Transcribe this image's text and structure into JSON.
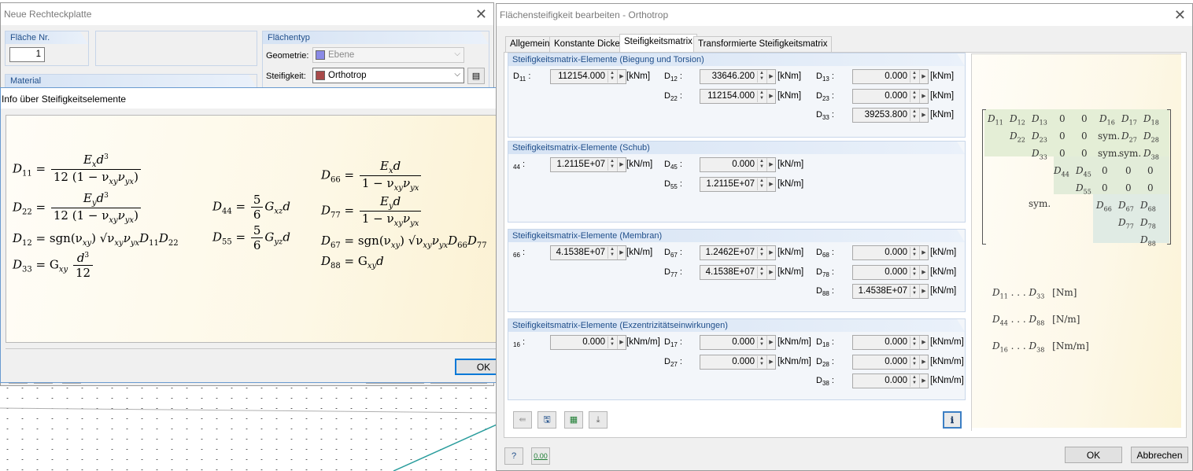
{
  "bg": {
    "window_title": "Neue Rechteckplatte",
    "flaeche_group": "Fläche Nr.",
    "flaeche_value": "1",
    "material_group": "Material",
    "flaechentyp_group": "Flächentyp",
    "geometrie_label": "Geometrie:",
    "geometrie_value": "Ebene",
    "steifigkeit_label": "Steifigkeit:",
    "steifigkeit_value": "Orthotrop",
    "geometrie_color": "#8a8ae6",
    "steifigkeit_color": "#a84a4a"
  },
  "info": {
    "title": "Info über Steifigkeitselemente",
    "ok": "OK",
    "f": {
      "d11": "D",
      "d11s": "11",
      "d11n": "E",
      "d11ns": "x",
      "d11n2": "d",
      "d11d": "12 (1 − ν",
      "d11ds": "xy",
      "d11d2": "ν",
      "d11ds2": "yx",
      "d11d3": ")",
      "d22": "D",
      "d22s": "22",
      "d22n": "E",
      "d22ns": "y",
      "d22n2": "d",
      "d22d": "12 (1 − ν",
      "d22ds": "xy",
      "d22d2": "ν",
      "d22ds2": "yx",
      "d22d3": ")",
      "d12": "D",
      "d12s": "12",
      "d12r": " = sgn(ν",
      "d12rs": "xy",
      "d12r2": ") √ν",
      "d12r2s": "xy",
      "d12r3": "ν",
      "d12r3s": "yx",
      "d12r4": "D",
      "d12r4s": "11",
      "d12r5": "D",
      "d12r5s": "22",
      "d33": "D",
      "d33s": "33",
      "d33r": " = G",
      "d33rs": "xy",
      "d33n": "d",
      "d33nsup": "3",
      "d33d": "12",
      "d44": "D",
      "d44s": "44",
      "d44n": "5",
      "d44d": "6",
      "d44r": "G",
      "d44rs": "xz",
      "d44r2": "d",
      "d55": "D",
      "d55s": "55",
      "d55n": "5",
      "d55d": "6",
      "d55r": "G",
      "d55rs": "yz",
      "d55r2": "d",
      "d66": "D",
      "d66s": "66",
      "d66n": "E",
      "d66ns": "x",
      "d66n2": "d",
      "d66d": "1 − ν",
      "d66ds": "xy",
      "d66d2": "ν",
      "d66ds2": "yx",
      "d77": "D",
      "d77s": "77",
      "d77n": "E",
      "d77ns": "y",
      "d77n2": "d",
      "d77d": "1 − ν",
      "d77ds": "xy",
      "d77d2": "ν",
      "d77ds2": "yx",
      "d67": "D",
      "d67s": "67",
      "d67r": " = sgn(ν",
      "d67rs": "xy",
      "d67r2": ") √ν",
      "d67r2s": "xy",
      "d67r3": "ν",
      "d67r3s": "yx",
      "d67r4": "D",
      "d67r4s": "66",
      "d67r5": "D",
      "d67r5s": "77",
      "d88": "D",
      "d88s": "88",
      "d88r": " = G",
      "d88rs": "xy",
      "d88r2": "d",
      "eq": " = ",
      "cube": "3"
    }
  },
  "main": {
    "title": "Flächensteifigkeit bearbeiten - Orthotrop",
    "tabs": [
      "Allgemein",
      "Konstante Dicke",
      "Steifigkeitsmatrix",
      "Transformierte Steifigkeitsmatrix"
    ],
    "groups": {
      "g1": {
        "title": "Steifigkeitsmatrix-Elemente (Biegung und Torsion)",
        "r": [
          {
            "l": "D",
            "s": "11",
            "v": "112154.000",
            "u": "[kNm]"
          },
          {
            "l": "D",
            "s": "12",
            "v": "33646.200",
            "u": "[kNm]"
          },
          {
            "l": "D",
            "s": "13",
            "v": "0.000",
            "u": "[kNm]"
          },
          {
            "l": "D",
            "s": "22",
            "v": "112154.000",
            "u": "[kNm]"
          },
          {
            "l": "D",
            "s": "23",
            "v": "0.000",
            "u": "[kNm]"
          },
          {
            "l": "D",
            "s": "33",
            "v": "39253.800",
            "u": "[kNm]"
          }
        ]
      },
      "g2": {
        "title": "Steifigkeitsmatrix-Elemente (Schub)",
        "r": [
          {
            "l": "",
            "s": "44",
            "v": "1.2115E+07",
            "u": "[kN/m]"
          },
          {
            "l": "D",
            "s": "45",
            "v": "0.000",
            "u": "[kN/m]"
          },
          {
            "l": "D",
            "s": "55",
            "v": "1.2115E+07",
            "u": "[kN/m]"
          }
        ]
      },
      "g3": {
        "title": "Steifigkeitsmatrix-Elemente (Membran)",
        "r": [
          {
            "l": "",
            "s": "66",
            "v": "4.1538E+07",
            "u": "[kN/m]"
          },
          {
            "l": "D",
            "s": "67",
            "v": "1.2462E+07",
            "u": "[kN/m]"
          },
          {
            "l": "D",
            "s": "68",
            "v": "0.000",
            "u": "[kN/m]"
          },
          {
            "l": "D",
            "s": "77",
            "v": "4.1538E+07",
            "u": "[kN/m]"
          },
          {
            "l": "D",
            "s": "78",
            "v": "0.000",
            "u": "[kN/m]"
          },
          {
            "l": "D",
            "s": "88",
            "v": "1.4538E+07",
            "u": "[kN/m]"
          }
        ]
      },
      "g4": {
        "title": "Steifigkeitsmatrix-Elemente (Exzentrizitätseinwirkungen)",
        "r": [
          {
            "l": "",
            "s": "16",
            "v": "0.000",
            "u": "[kNm/m]"
          },
          {
            "l": "D",
            "s": "17",
            "v": "0.000",
            "u": "[kNm/m]"
          },
          {
            "l": "D",
            "s": "18",
            "v": "0.000",
            "u": "[kNm/m]"
          },
          {
            "l": "D",
            "s": "27",
            "v": "0.000",
            "u": "[kNm/m]"
          },
          {
            "l": "D",
            "s": "28",
            "v": "0.000",
            "u": "[kNm/m]"
          },
          {
            "l": "D",
            "s": "38",
            "v": "0.000",
            "u": "[kNm/m]"
          }
        ]
      }
    },
    "matrix": {
      "cells": [
        "D11",
        "D12",
        "D13",
        "0",
        "0",
        "D16",
        "D17",
        "D18",
        "D22",
        "D23",
        "0",
        "0",
        "sym.",
        "D27",
        "D28",
        "D33",
        "0",
        "0",
        "sym.",
        "sym.",
        "D38",
        "D44",
        "D45",
        "0",
        "0",
        "0",
        "D55",
        "0",
        "0",
        "0",
        "sym.",
        "D66",
        "D67",
        "D68",
        "D77",
        "D78",
        "D88"
      ],
      "units": [
        {
          "r": "D11 ... D33",
          "u": "[Nm]"
        },
        {
          "r": "D44 ... D88",
          "u": "[N/m]"
        },
        {
          "r": "D16 ... D38",
          "u": "[Nm/m]"
        }
      ]
    },
    "ok": "OK",
    "cancel": "Abbrechen",
    "zero_icon": "0.00"
  }
}
